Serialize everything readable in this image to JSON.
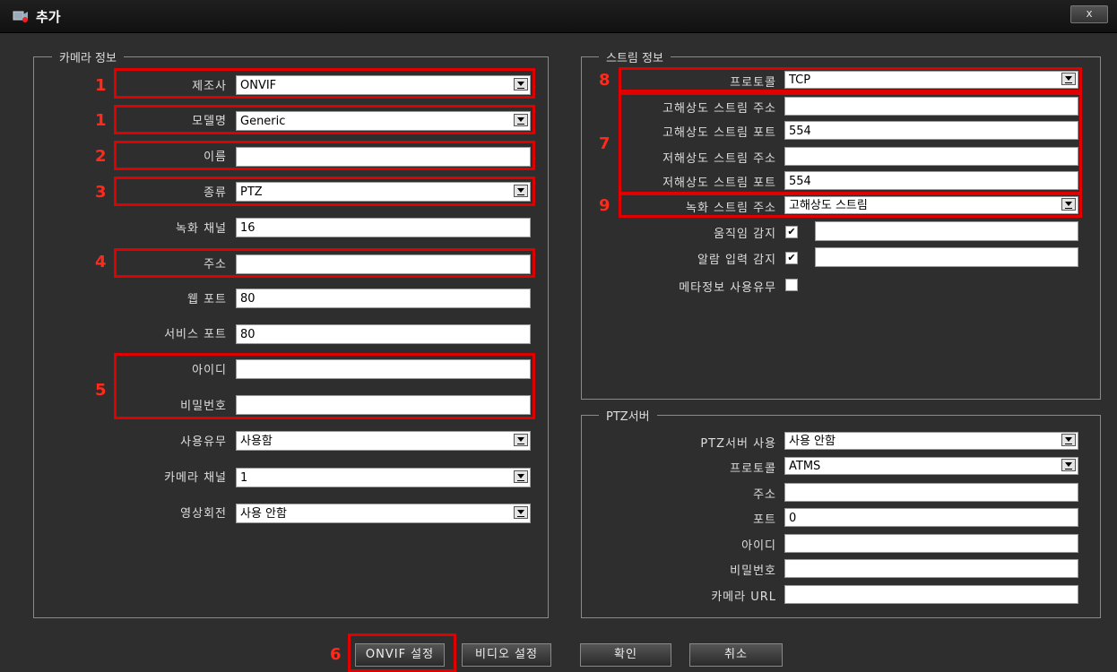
{
  "window": {
    "title": "추가",
    "close_label": "x"
  },
  "camera_info": {
    "legend": "카메라 정보",
    "manufacturer": {
      "label": "제조사",
      "value": "ONVIF"
    },
    "model": {
      "label": "모델명",
      "value": "Generic"
    },
    "name": {
      "label": "이름",
      "value": ""
    },
    "type": {
      "label": "종류",
      "value": "PTZ"
    },
    "record_channel": {
      "label": "녹화 채널",
      "value": "16"
    },
    "address": {
      "label": "주소",
      "value": ""
    },
    "web_port": {
      "label": "웹 포트",
      "value": "80"
    },
    "service_port": {
      "label": "서비스 포트",
      "value": "80"
    },
    "user_id": {
      "label": "아이디",
      "value": ""
    },
    "password": {
      "label": "비밀번호",
      "value": ""
    },
    "use": {
      "label": "사용유무",
      "value": "사용함"
    },
    "camera_channel": {
      "label": "카메라 채널",
      "value": "1"
    },
    "rotation": {
      "label": "영상회전",
      "value": "사용 안함"
    }
  },
  "stream_info": {
    "legend": "스트림 정보",
    "protocol": {
      "label": "프로토콜",
      "value": "TCP"
    },
    "hi_addr": {
      "label": "고해상도 스트림 주소",
      "value": ""
    },
    "hi_port": {
      "label": "고해상도 스트림 포트",
      "value": "554"
    },
    "lo_addr": {
      "label": "저해상도 스트림 주소",
      "value": ""
    },
    "lo_port": {
      "label": "저해상도 스트림 포트",
      "value": "554"
    },
    "rec_stream": {
      "label": "녹화 스트림 주소",
      "value": "고해상도 스트림"
    },
    "motion": {
      "label": "움직임 감지",
      "checked": true,
      "value": ""
    },
    "alarm": {
      "label": "알람 입력 감지",
      "checked": true,
      "value": ""
    },
    "meta": {
      "label": "메타정보 사용유무",
      "checked": false
    }
  },
  "ptz_server": {
    "legend": "PTZ서버",
    "use": {
      "label": "PTZ서버 사용",
      "value": "사용 안함"
    },
    "protocol": {
      "label": "프로토콜",
      "value": "ATMS"
    },
    "address": {
      "label": "주소",
      "value": ""
    },
    "port": {
      "label": "포트",
      "value": "0"
    },
    "user_id": {
      "label": "아이디",
      "value": ""
    },
    "password": {
      "label": "비밀번호",
      "value": ""
    },
    "camera_url": {
      "label": "카메라 URL",
      "value": ""
    }
  },
  "buttons": {
    "onvif": "ONVIF 설정",
    "video": "비디오 설정",
    "ok": "확인",
    "cancel": "취소"
  },
  "markers": {
    "m1a": "1",
    "m1b": "1",
    "m2": "2",
    "m3": "3",
    "m4": "4",
    "m5": "5",
    "m6": "6",
    "m7": "7",
    "m8": "8",
    "m9": "9"
  },
  "colors": {
    "marker": "#e00000",
    "background": "#2e2e2e"
  }
}
